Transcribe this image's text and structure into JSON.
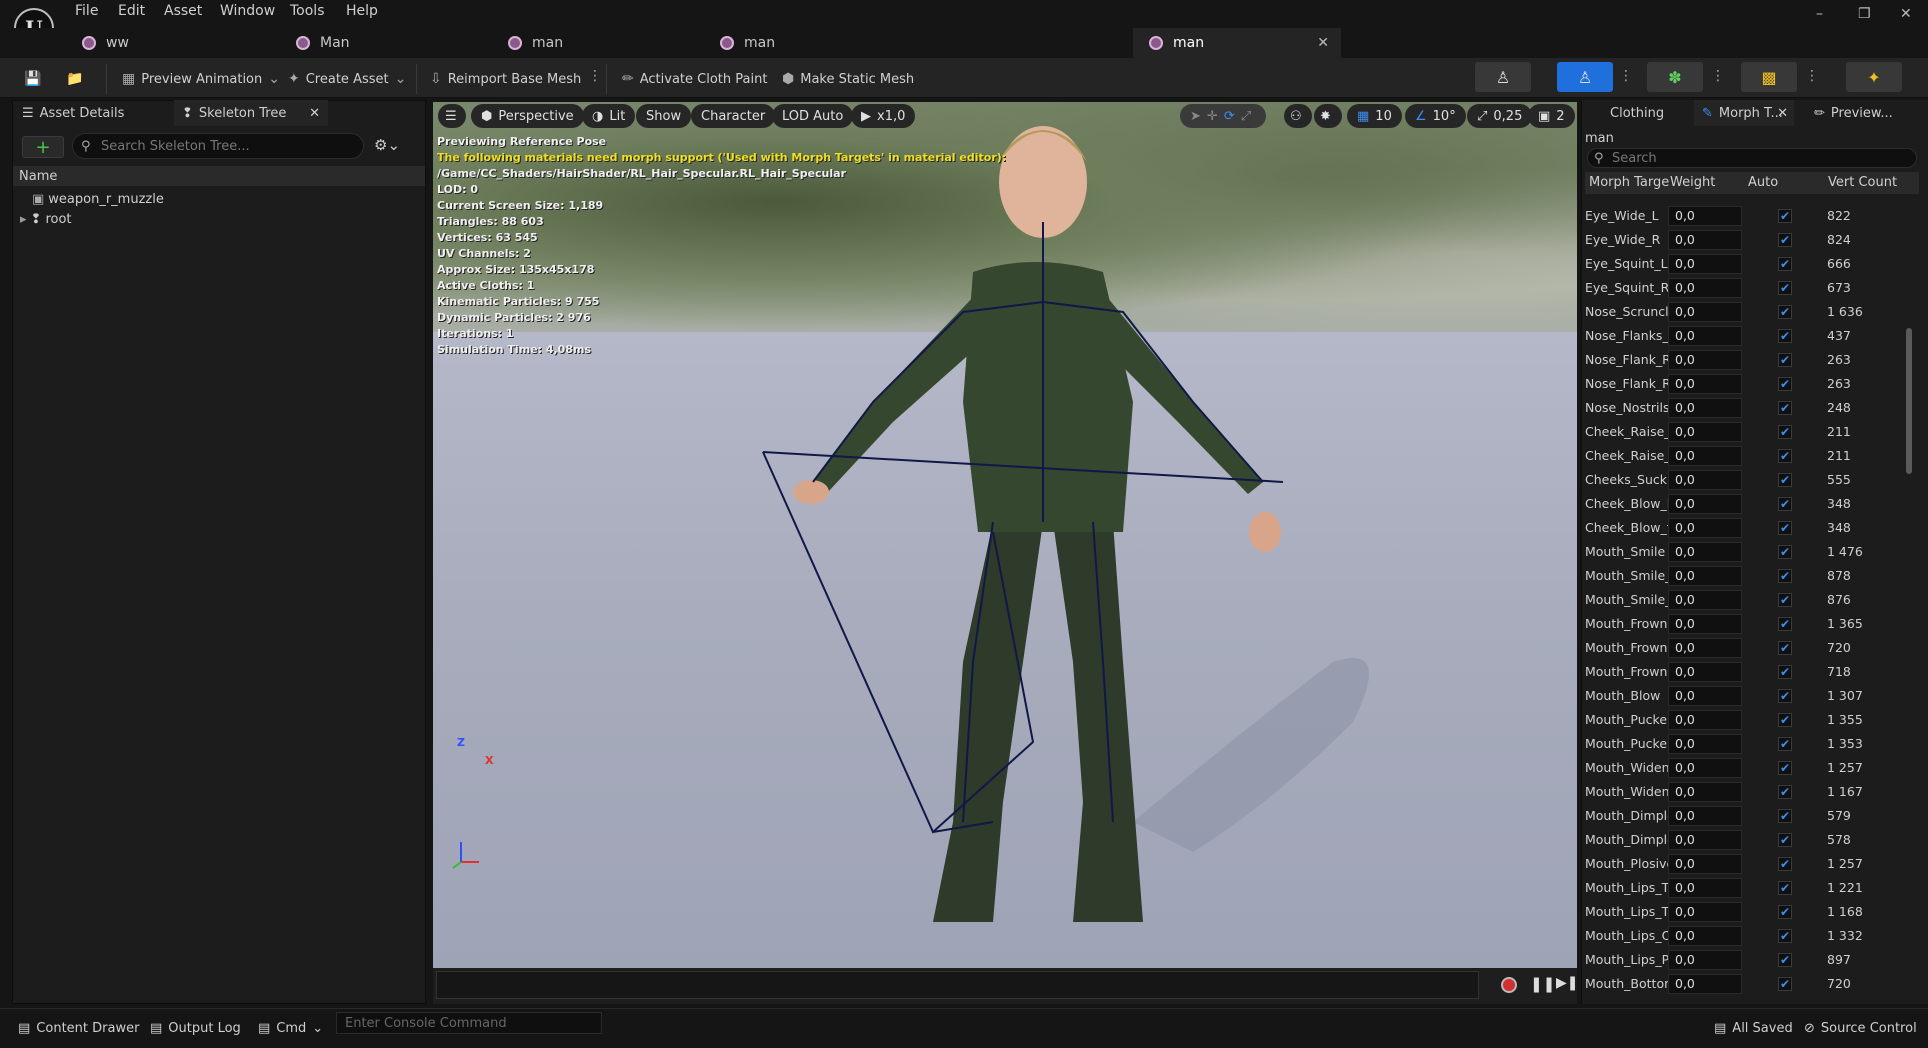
{
  "menu": [
    "File",
    "Edit",
    "Asset",
    "Window",
    "Tools",
    "Help"
  ],
  "doc_tabs": [
    {
      "label": "ww"
    },
    {
      "label": "Man"
    },
    {
      "label": "man"
    },
    {
      "label": "man"
    },
    {
      "label": "man",
      "active": true
    }
  ],
  "toolbar": {
    "preview_animation": "Preview Animation",
    "create_asset": "Create Asset",
    "reimport": "Reimport Base Mesh",
    "activate_cloth": "Activate Cloth Paint",
    "make_static": "Make Static Mesh"
  },
  "left_panel": {
    "tabs": [
      "Asset Details",
      "Skeleton Tree"
    ],
    "search_placeholder": "Search Skeleton Tree...",
    "column": "Name",
    "tree": [
      "weapon_r_muzzle",
      "root"
    ]
  },
  "viewport": {
    "buttons": [
      "Perspective",
      "Lit",
      "Show",
      "Character",
      "LOD Auto",
      "x1,0"
    ],
    "right_controls": {
      "grid": "10",
      "angle": "10°",
      "scale": "0,25",
      "camera": "2"
    },
    "info": {
      "line1": "Previewing Reference Pose",
      "warning": "The following materials need morph support ('Used with Morph Targets' in material editor):",
      "path": "/Game/CC_Shaders/HairShader/RL_Hair_Specular.RL_Hair_Specular",
      "lines": [
        "LOD: 0",
        "Current Screen Size: 1,189",
        "Triangles: 88 603",
        "Vertices: 63 545",
        "UV Channels: 2",
        "Approx Size: 135x45x178",
        "Active Cloths: 1",
        "Kinematic Particles: 9 755",
        "Dynamic Particles: 2 976",
        "Iterations: 1",
        "Simulation Time: 4,08ms"
      ]
    },
    "axis": {
      "z": "Z",
      "x": "X"
    }
  },
  "right_panel": {
    "tabs": [
      "Clothing",
      "Morph T...",
      "Preview..."
    ],
    "asset": "man",
    "search_placeholder": "Search",
    "columns": [
      "Morph Targe",
      "Weight",
      "Auto",
      "Vert Count"
    ],
    "rows": [
      {
        "name": "Eye_Wide_L",
        "weight": "0,0",
        "count": "822"
      },
      {
        "name": "Eye_Wide_R",
        "weight": "0,0",
        "count": "824"
      },
      {
        "name": "Eye_Squint_L",
        "weight": "0,0",
        "count": "666"
      },
      {
        "name": "Eye_Squint_R",
        "weight": "0,0",
        "count": "673"
      },
      {
        "name": "Nose_Scruncl",
        "weight": "0,0",
        "count": "1 636"
      },
      {
        "name": "Nose_Flanks_",
        "weight": "0,0",
        "count": "437"
      },
      {
        "name": "Nose_Flank_R",
        "weight": "0,0",
        "count": "263"
      },
      {
        "name": "Nose_Flank_R",
        "weight": "0,0",
        "count": "263"
      },
      {
        "name": "Nose_Nostrils",
        "weight": "0,0",
        "count": "248"
      },
      {
        "name": "Cheek_Raise_",
        "weight": "0,0",
        "count": "211"
      },
      {
        "name": "Cheek_Raise_",
        "weight": "0,0",
        "count": "211"
      },
      {
        "name": "Cheeks_Suck",
        "weight": "0,0",
        "count": "555"
      },
      {
        "name": "Cheek_Blow_l",
        "weight": "0,0",
        "count": "348"
      },
      {
        "name": "Cheek_Blow_f",
        "weight": "0,0",
        "count": "348"
      },
      {
        "name": "Mouth_Smile",
        "weight": "0,0",
        "count": "1 476"
      },
      {
        "name": "Mouth_Smile_",
        "weight": "0,0",
        "count": "878"
      },
      {
        "name": "Mouth_Smile_",
        "weight": "0,0",
        "count": "876"
      },
      {
        "name": "Mouth_Frown",
        "weight": "0,0",
        "count": "1 365"
      },
      {
        "name": "Mouth_Frown,",
        "weight": "0,0",
        "count": "720"
      },
      {
        "name": "Mouth_Frown,",
        "weight": "0,0",
        "count": "718"
      },
      {
        "name": "Mouth_Blow",
        "weight": "0,0",
        "count": "1 307"
      },
      {
        "name": "Mouth_Pucker",
        "weight": "0,0",
        "count": "1 355"
      },
      {
        "name": "Mouth_Pucker",
        "weight": "0,0",
        "count": "1 353"
      },
      {
        "name": "Mouth_Widen",
        "weight": "0,0",
        "count": "1 257"
      },
      {
        "name": "Mouth_Widen_",
        "weight": "0,0",
        "count": "1 167"
      },
      {
        "name": "Mouth_Dimple",
        "weight": "0,0",
        "count": "579"
      },
      {
        "name": "Mouth_Dimple",
        "weight": "0,0",
        "count": "578"
      },
      {
        "name": "Mouth_Plosive",
        "weight": "0,0",
        "count": "1 257"
      },
      {
        "name": "Mouth_Lips_T",
        "weight": "0,0",
        "count": "1 221"
      },
      {
        "name": "Mouth_Lips_T",
        "weight": "0,0",
        "count": "1 168"
      },
      {
        "name": "Mouth_Lips_O",
        "weight": "0,0",
        "count": "1 332"
      },
      {
        "name": "Mouth_Lips_P",
        "weight": "0,0",
        "count": "897"
      },
      {
        "name": "Mouth_Bottom",
        "weight": "0,0",
        "count": "720"
      }
    ]
  },
  "statusbar": {
    "content_drawer": "Content Drawer",
    "output_log": "Output Log",
    "cmd": "Cmd",
    "console_placeholder": "Enter Console Command",
    "all_saved": "All Saved",
    "source_control": "Source Control"
  }
}
